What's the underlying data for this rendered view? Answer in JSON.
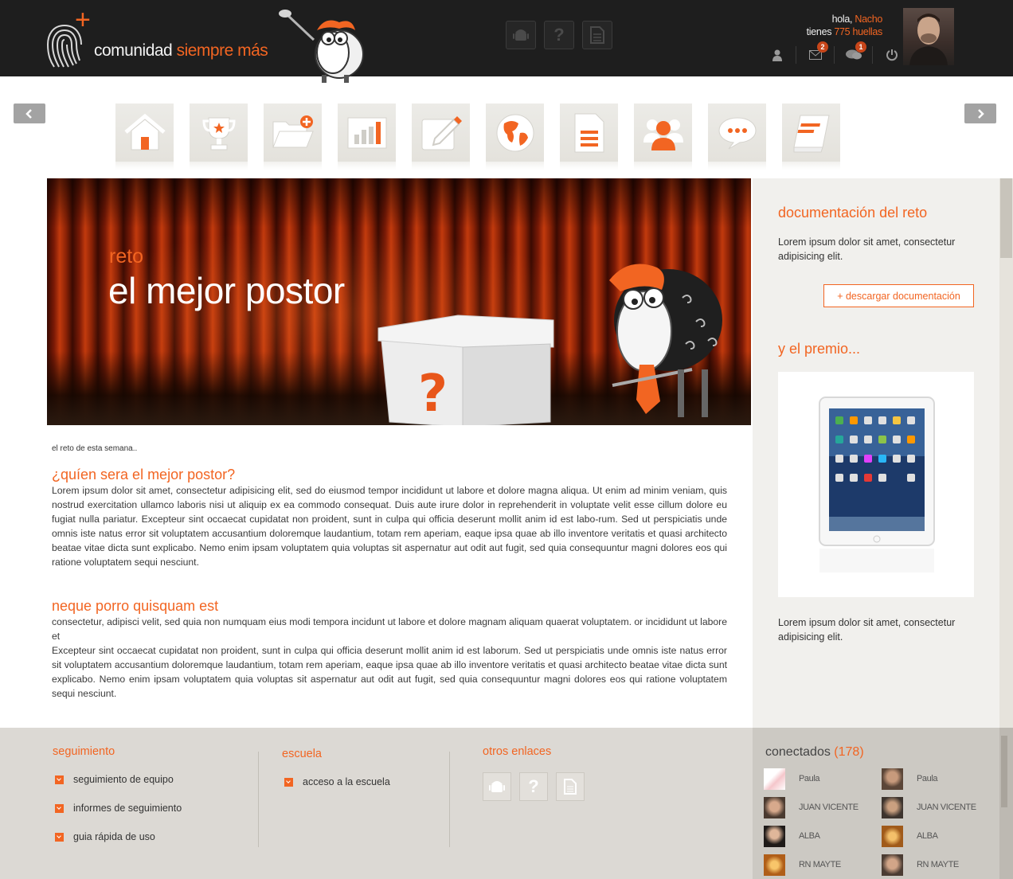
{
  "header": {
    "logo_text": "comunidad",
    "logo_accent": "siempre más",
    "greeting_prefix": "hola,",
    "user_name": "Nacho",
    "points_prefix": "tienes",
    "points": "775 huellas",
    "messages_badge": "2",
    "comments_badge": "1",
    "buttons": [
      "android-icon",
      "help-icon",
      "document-icon"
    ]
  },
  "nav": {
    "items": [
      "home-icon",
      "trophy-icon",
      "add-folder-icon",
      "stats-chart-icon",
      "edit-icon",
      "globe-icon",
      "document-icon",
      "users-icon",
      "chat-icon",
      "notebook-icon"
    ]
  },
  "banner": {
    "subtitle": "reto",
    "title": "el mejor postor"
  },
  "article": {
    "intro": "el reto de esta semana..",
    "section1_title": "¿quíen sera el mejor postor?",
    "section1_text": "Lorem ipsum dolor sit amet, consectetur adipisicing elit, sed do eiusmod tempor incididunt ut labore et dolore magna aliqua. Ut enim ad minim veniam, quis nostrud exercitation ullamco laboris nisi ut aliquip ex ea commodo consequat. Duis aute irure dolor in reprehenderit in voluptate velit esse cillum dolore eu fugiat nulla pariatur. Excepteur sint occaecat cupidatat non proident, sunt in culpa qui officia deserunt mollit anim id est labo-rum. Sed ut perspiciatis unde omnis iste natus error sit voluptatem accusantium doloremque laudantium, totam rem aperiam, eaque ipsa quae ab illo inventore veritatis et quasi architecto beatae vitae dicta sunt explicabo. Nemo enim ipsam voluptatem quia voluptas sit aspernatur aut odit aut fugit, sed quia consequuntur magni dolores eos qui ratione voluptatem sequi nesciunt.",
    "section2_title": "neque porro quisquam est",
    "section2_text_a": "consectetur, adipisci velit, sed quia non numquam eius modi tempora incidunt ut labore et dolore magnam aliquam quaerat voluptatem. or incididunt ut labore et",
    "section2_text_b": "Excepteur sint occaecat cupidatat non proident, sunt in culpa qui officia deserunt mollit anim id est laborum. Sed ut perspiciatis unde omnis iste natus error sit voluptatem accusantium doloremque laudantium, totam rem aperiam, eaque ipsa quae ab illo inventore veritatis et quasi architecto beatae vitae dicta sunt explicabo. Nemo enim ipsam voluptatem quia voluptas sit aspernatur aut odit aut fugit, sed quia consequuntur magni dolores eos qui ratione voluptatem sequi nesciunt."
  },
  "sidebar": {
    "doc_title": "documentación del reto",
    "doc_text": "Lorem ipsum dolor sit amet, consectetur adipisicing elit.",
    "download_label": "+ descargar documentación",
    "prize_title": "y el premio...",
    "prize_text": "Lorem ipsum dolor sit amet, consectetur adipisicing elit."
  },
  "footer": {
    "col1_title": "seguimiento",
    "col1_items": [
      "seguimiento de equipo",
      "informes de seguimiento",
      "guia rápida de uso"
    ],
    "col2_title": "escuela",
    "col2_items": [
      "acceso a la escuela"
    ],
    "col3_title": "otros enlaces"
  },
  "online": {
    "title": "conectados",
    "count": "(178)",
    "users": [
      "Paula",
      "Paula",
      "JUAN VICENTE",
      "JUAN VICENTE",
      "ALBA",
      "ALBA",
      "RN MAYTE",
      "RN MAYTE"
    ]
  },
  "colors": {
    "accent": "#f26522",
    "header_bg": "#1e1e1e",
    "footer_bg": "#dcd9d4"
  }
}
